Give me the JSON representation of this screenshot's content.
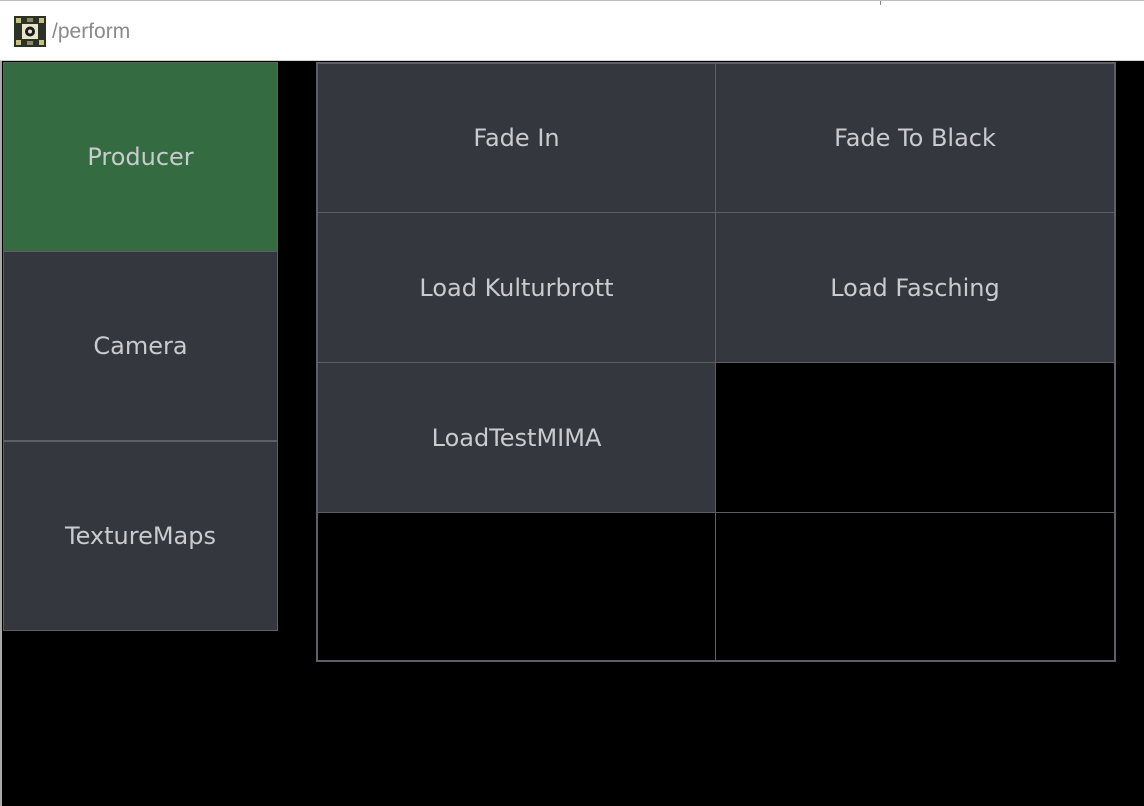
{
  "window": {
    "title": "/perform"
  },
  "sidebar": {
    "items": [
      {
        "label": "Producer",
        "active": true
      },
      {
        "label": "Camera",
        "active": false
      },
      {
        "label": "TextureMaps",
        "active": false
      }
    ]
  },
  "grid": {
    "columns": 2,
    "rows": 4,
    "buttons": [
      "Fade In",
      "Fade To Black",
      "Load Kulturbrott",
      "Load Fasching",
      "LoadTestMIMA",
      "",
      "",
      ""
    ]
  },
  "colors": {
    "active_tab": "#356b40",
    "button_bg": "#35373f",
    "border": "#5c5f66",
    "text": "#c9cbce",
    "background": "#000000"
  }
}
